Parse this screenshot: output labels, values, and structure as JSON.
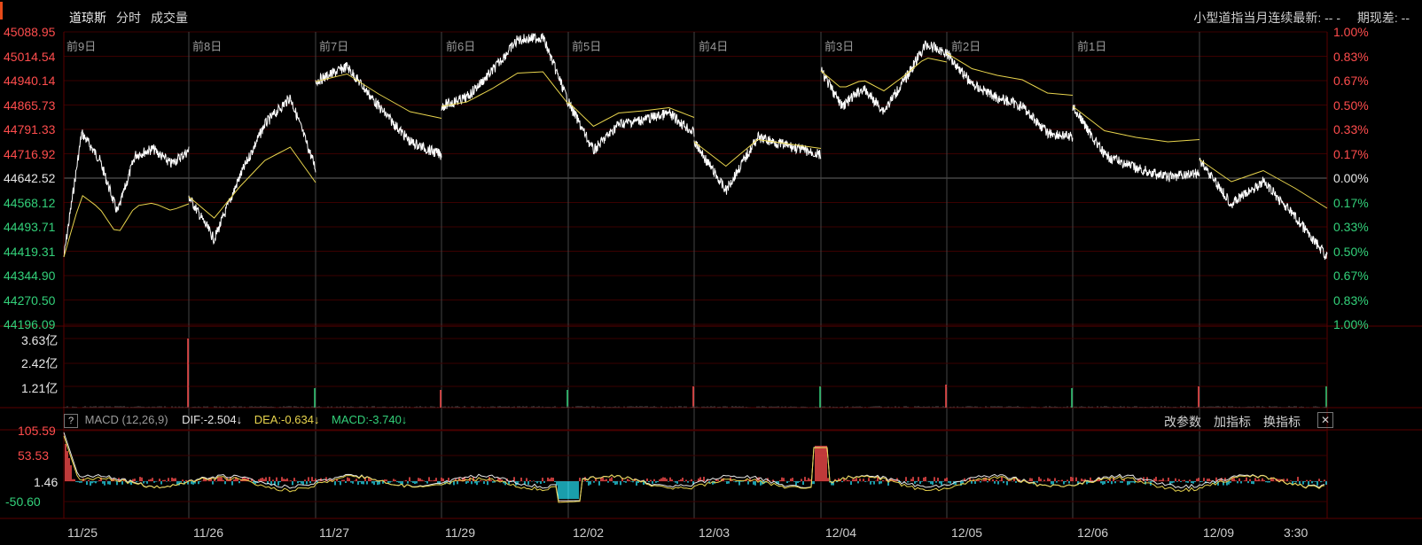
{
  "header": {
    "tabs": [
      {
        "label": "道琼斯"
      },
      {
        "label": "分时"
      },
      {
        "label": "成交量"
      }
    ],
    "info_label": "小型道指当月连续最新: -- -",
    "spread_label": "期现差: --"
  },
  "price_axis": {
    "left_labels": [
      "45088.95",
      "45014.54",
      "44940.14",
      "44865.73",
      "44791.33",
      "44716.92",
      "44642.52",
      "44568.12",
      "44493.71",
      "44419.31",
      "44344.90",
      "44270.50",
      "44196.09"
    ],
    "right_labels": [
      "1.00%",
      "0.83%",
      "0.67%",
      "0.50%",
      "0.33%",
      "0.17%",
      "0.00%",
      "0.17%",
      "0.33%",
      "0.50%",
      "0.67%",
      "0.83%",
      "1.00%"
    ]
  },
  "day_labels": [
    "前9日",
    "前8日",
    "前7日",
    "前6日",
    "前5日",
    "前4日",
    "前3日",
    "前2日",
    "前1日"
  ],
  "volume_axis": [
    "3.63亿",
    "2.42亿",
    "1.21亿"
  ],
  "macd": {
    "help": "?",
    "title": "MACD (12,26,9)",
    "dif": "DIF:-2.504↓",
    "dea": "DEA:-0.634↓",
    "macd": "MACD:-3.740↓",
    "buttons": [
      "改参数",
      "加指标",
      "换指标"
    ],
    "close": "✕",
    "axis_labels": [
      "105.59",
      "53.53",
      "1.46",
      "-50.60"
    ]
  },
  "x_labels": [
    "11/25",
    "11/26",
    "11/27",
    "11/29",
    "12/02",
    "12/03",
    "12/04",
    "12/05",
    "12/06",
    "12/09",
    "3:30"
  ],
  "colors": {
    "up": "#ff4d4d",
    "down": "#33d17a",
    "price": "#ffffff",
    "avg": "#e8d44d",
    "cyan": "#22d3e6",
    "grid": "#3a0000"
  }
}
